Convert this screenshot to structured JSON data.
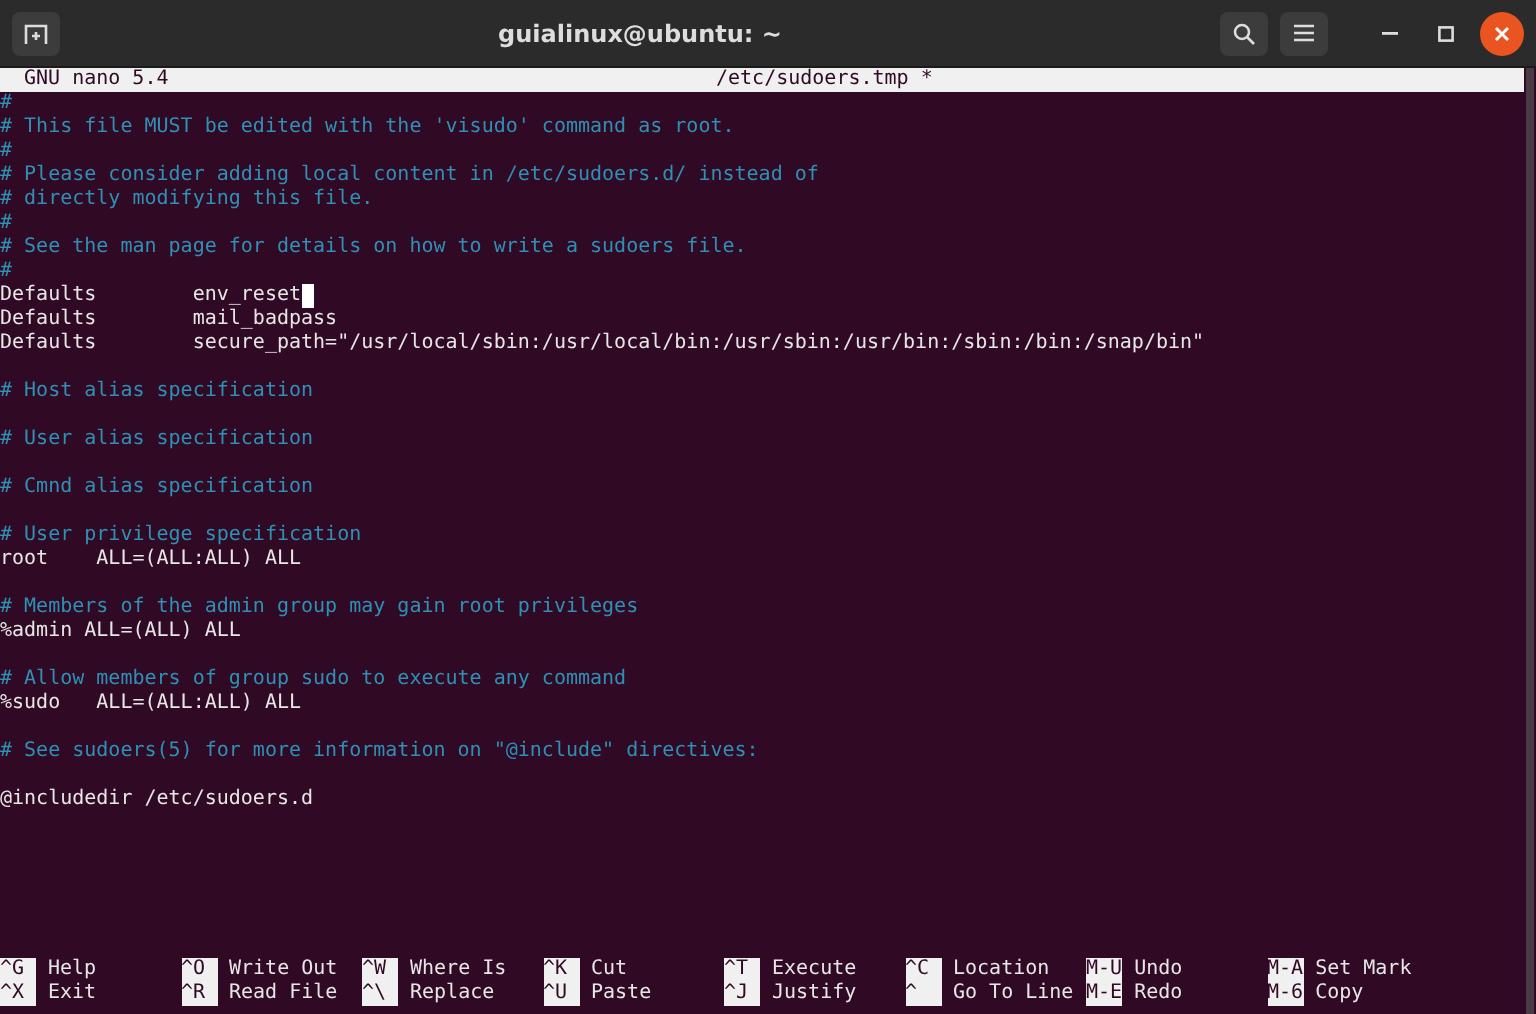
{
  "window": {
    "title": "guialinux@ubuntu: ~"
  },
  "nano_header": {
    "version": "GNU nano 5.4",
    "filename": "/etc/sudoers.tmp *"
  },
  "lines": [
    {
      "kind": "comment",
      "text": "#"
    },
    {
      "kind": "comment",
      "text": "# This file MUST be edited with the 'visudo' command as root."
    },
    {
      "kind": "comment",
      "text": "#"
    },
    {
      "kind": "comment",
      "text": "# Please consider adding local content in /etc/sudoers.d/ instead of"
    },
    {
      "kind": "comment",
      "text": "# directly modifying this file."
    },
    {
      "kind": "comment",
      "text": "#"
    },
    {
      "kind": "comment",
      "text": "# See the man page for details on how to write a sudoers file."
    },
    {
      "kind": "comment",
      "text": "#"
    },
    {
      "kind": "code",
      "text": "Defaults        env_reset",
      "cursor": true
    },
    {
      "kind": "code",
      "text": "Defaults        mail_badpass",
      "cursor": false
    },
    {
      "kind": "code",
      "text": "Defaults        secure_path=\"/usr/local/sbin:/usr/local/bin:/usr/sbin:/usr/bin:/sbin:/bin:/snap/bin\"",
      "cursor": false
    },
    {
      "kind": "blank"
    },
    {
      "kind": "comment",
      "text": "# Host alias specification"
    },
    {
      "kind": "blank"
    },
    {
      "kind": "comment",
      "text": "# User alias specification"
    },
    {
      "kind": "blank"
    },
    {
      "kind": "comment",
      "text": "# Cmnd alias specification"
    },
    {
      "kind": "blank"
    },
    {
      "kind": "comment",
      "text": "# User privilege specification"
    },
    {
      "kind": "code",
      "text": "root    ALL=(ALL:ALL) ALL",
      "cursor": false
    },
    {
      "kind": "blank"
    },
    {
      "kind": "comment",
      "text": "# Members of the admin group may gain root privileges"
    },
    {
      "kind": "code",
      "text": "%admin ALL=(ALL) ALL",
      "cursor": false
    },
    {
      "kind": "blank"
    },
    {
      "kind": "comment",
      "text": "# Allow members of group sudo to execute any command"
    },
    {
      "kind": "code",
      "text": "%sudo   ALL=(ALL:ALL) ALL",
      "cursor": false
    },
    {
      "kind": "blank"
    },
    {
      "kind": "comment",
      "text": "# See sudoers(5) for more information on \"@include\" directives:"
    },
    {
      "kind": "blank"
    },
    {
      "kind": "code",
      "text": "@includedir /etc/sudoers.d",
      "cursor": false
    }
  ],
  "shortcuts": [
    {
      "key": "^G",
      "label": "Help"
    },
    {
      "key": "^O",
      "label": "Write Out"
    },
    {
      "key": "^W",
      "label": "Where Is"
    },
    {
      "key": "^K",
      "label": "Cut"
    },
    {
      "key": "^T",
      "label": "Execute"
    },
    {
      "key": "^C",
      "label": "Location"
    },
    {
      "key": "M-U",
      "label": "Undo"
    },
    {
      "key": "M-A",
      "label": "Set Mark"
    },
    {
      "key": "^X",
      "label": "Exit"
    },
    {
      "key": "^R",
      "label": "Read File"
    },
    {
      "key": "^\\",
      "label": "Replace"
    },
    {
      "key": "^U",
      "label": "Paste"
    },
    {
      "key": "^J",
      "label": "Justify"
    },
    {
      "key": "^",
      "label": "Go To Line"
    },
    {
      "key": "M-E",
      "label": "Redo"
    },
    {
      "key": "M-6",
      "label": "Copy"
    }
  ]
}
